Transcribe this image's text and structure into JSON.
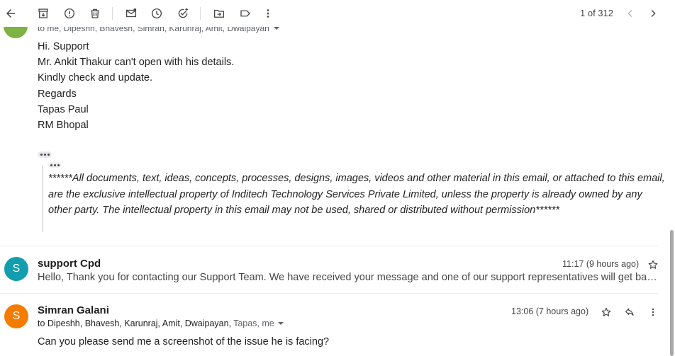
{
  "toolbar": {
    "counter": "1 of 312"
  },
  "message1": {
    "recipients": "to me, Dipeshh, Bhavesh, Simran, Karunraj, Amit, Dwaipayan",
    "body": [
      "Hi. Support",
      "Mr. Ankit Thakur can't open with his details.",
      "Kindly check and update.",
      "Regards",
      "Tapas Paul",
      "RM Bhopal"
    ],
    "disclaimer": "******All documents, text, ideas, concepts, processes, designs, images, videos and other material in this email, or attached to this email, are the exclusive intellectual property of Inditech Technology Services Private Limited, unless the property is already owned by any other party. The intellectual property in this email may not be used, shared or distributed without permission******"
  },
  "message2": {
    "avatar_letter": "S",
    "avatar_color": "#129eaf",
    "sender": "support Cpd",
    "time": "11:17 (9 hours ago)",
    "snippet": "Hello, Thank you for contacting our Support Team. We have received your message and one of our support representatives will get back to you shortly."
  },
  "message3": {
    "avatar_letter": "S",
    "avatar_color": "#f57c00",
    "sender": "Simran Galani",
    "time": "13:06 (7 hours ago)",
    "recipients_main": "to Dipeshh, Bhavesh, Karunraj, Amit, Dwaipayan,",
    "recipients_muted": "Tapas, me",
    "body": "Can you please send me a screenshot of the issue he is facing?"
  },
  "colors": {
    "message1_avatar": "#7cb342"
  },
  "icons": [
    "back-arrow-icon",
    "archive-icon",
    "report-spam-icon",
    "delete-icon",
    "mark-unread-icon",
    "snooze-icon",
    "add-task-icon",
    "move-to-icon",
    "label-icon",
    "more-vert-icon",
    "chevron-left-icon",
    "chevron-right-icon",
    "star-icon",
    "reply-icon"
  ]
}
